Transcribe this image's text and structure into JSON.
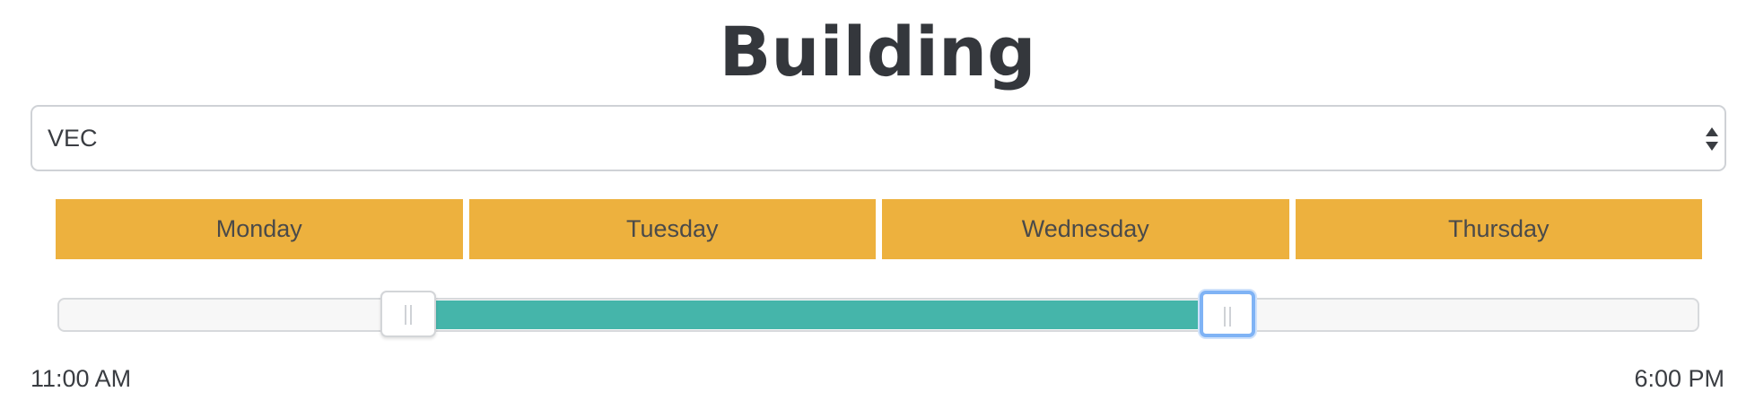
{
  "page": {
    "title": "Building"
  },
  "building_select": {
    "selected": "VEC",
    "arrow_icon": "up-down-arrows-icon"
  },
  "day_tabs": [
    {
      "label": "Monday"
    },
    {
      "label": "Tuesday"
    },
    {
      "label": "Wednesday"
    },
    {
      "label": "Thursday"
    }
  ],
  "time_slider": {
    "start_label": "11:00 AM",
    "end_label": "6:00 PM",
    "lower_fraction": 0.214,
    "upper_fraction": 0.714,
    "active_handle": "upper",
    "range_color": "#45b5aa",
    "tab_color": "#edb13e",
    "focus_color": "#7fb3f5"
  }
}
